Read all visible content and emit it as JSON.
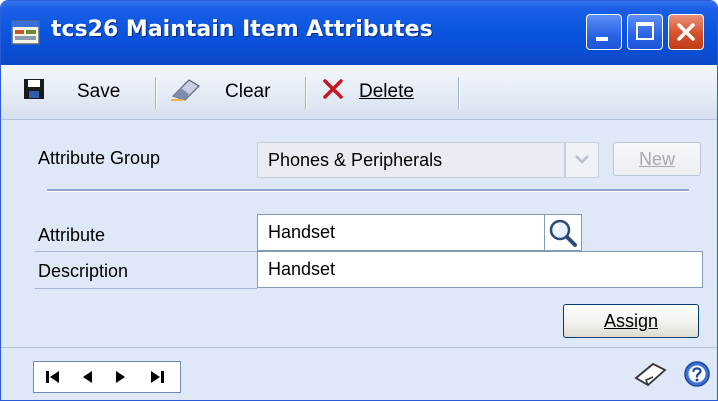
{
  "window": {
    "title": "tcs26 Maintain Item Attributes",
    "controls": {
      "minimize": "minimize-icon",
      "maximize": "maximize-icon",
      "close": "close-icon"
    }
  },
  "toolbar": {
    "save_label": "Save",
    "clear_label": "Clear",
    "delete_label": "Delete"
  },
  "form": {
    "attribute_group_label": "Attribute Group",
    "attribute_group_value": "Phones & Peripherals",
    "new_button_label": "New",
    "attribute_label": "Attribute",
    "attribute_value": "Handset",
    "description_label": "Description",
    "description_value": "Handset",
    "assign_button_label": "Assign"
  },
  "colors": {
    "titlebar": "#0b56e0",
    "window_bg": "#dfe8f6",
    "close_button": "#d5512b"
  },
  "statusbar": {
    "nav_icons": [
      "first-record-icon",
      "previous-record-icon",
      "next-record-icon",
      "last-record-icon"
    ],
    "note_icon": "note-icon",
    "help_icon": "help-icon"
  }
}
